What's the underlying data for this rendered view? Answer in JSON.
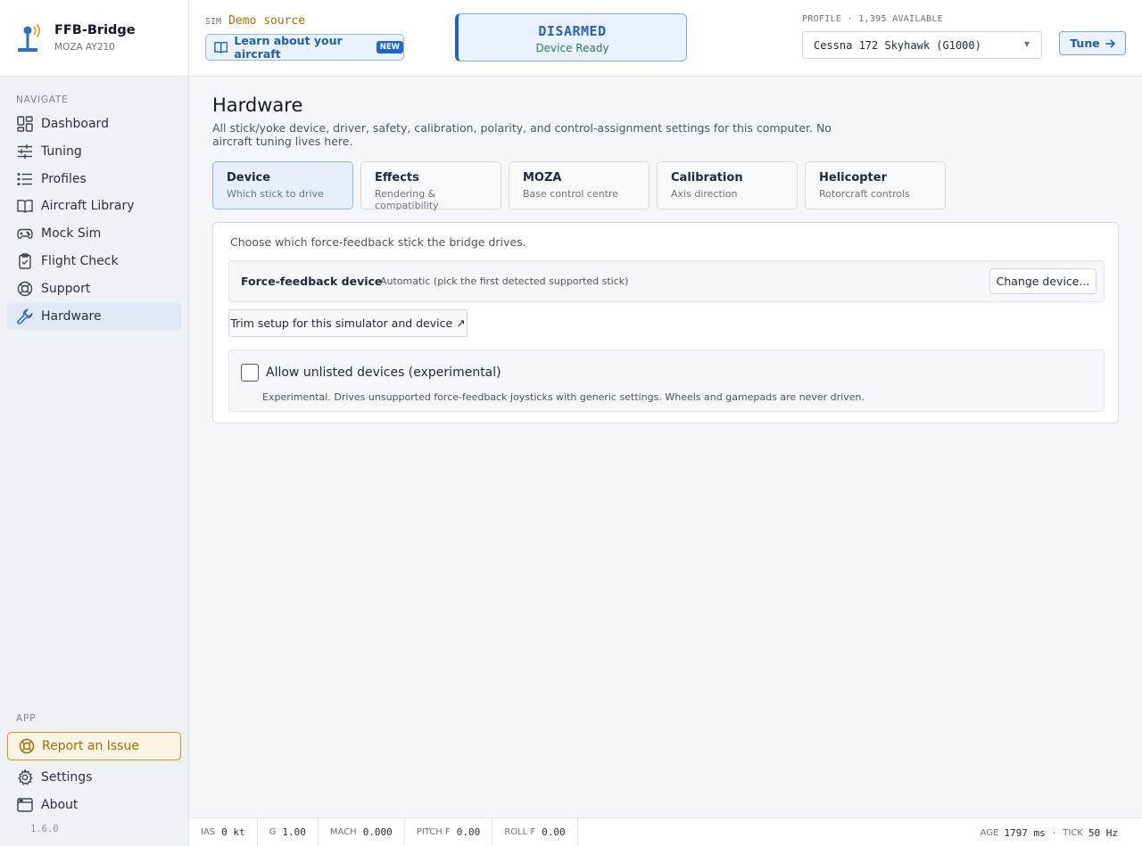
{
  "brand": {
    "title": "FFB-Bridge",
    "subtitle": "MOZA AY210"
  },
  "sidebar": {
    "navigate_heading": "NAVIGATE",
    "items": [
      {
        "label": "Dashboard",
        "icon": "dashboard-icon"
      },
      {
        "label": "Tuning",
        "icon": "sliders-icon"
      },
      {
        "label": "Profiles",
        "icon": "list-icon"
      },
      {
        "label": "Aircraft Library",
        "icon": "book-icon"
      },
      {
        "label": "Mock Sim",
        "icon": "gamepad-icon"
      },
      {
        "label": "Flight Check",
        "icon": "clipboard-check-icon"
      },
      {
        "label": "Support",
        "icon": "lifebuoy-icon"
      },
      {
        "label": "Hardware",
        "icon": "wrench-icon",
        "active": true
      }
    ],
    "app_heading": "APP",
    "report_label": "Report an Issue",
    "settings_label": "Settings",
    "about_label": "About",
    "version": "1.6.0"
  },
  "header": {
    "sim_tag": "SIM",
    "sim_source": "Demo source",
    "learn_label": "Learn about your aircraft",
    "new_badge": "NEW",
    "status_main": "DISARMED",
    "status_sub": "Device Ready",
    "profile_label": "PROFILE · 1,395 AVAILABLE",
    "profile_value": "Cessna 172 Skyhawk (G1000)",
    "tune_label": "Tune"
  },
  "main": {
    "title": "Hardware",
    "description": "All stick/yoke device, driver, safety, calibration, polarity, and control-assignment settings for this computer. No aircraft tuning lives here.",
    "tabs": [
      {
        "label": "Device",
        "sub": "Which stick to drive",
        "active": true
      },
      {
        "label": "Effects",
        "sub": "Rendering & compatibility"
      },
      {
        "label": "MOZA",
        "sub": "Base control centre"
      },
      {
        "label": "Calibration",
        "sub": "Axis direction"
      },
      {
        "label": "Helicopter",
        "sub": "Rotorcraft controls"
      }
    ],
    "panel": {
      "intro": "Choose which force-feedback stick the bridge drives.",
      "ffb_name": "Force-feedback device",
      "ffb_value": "Automatic (pick the first detected supported stick)",
      "change_label": "Change device...",
      "trim_label": "Trim setup for this simulator and device ↗",
      "unlisted_label": "Allow unlisted devices (experimental)",
      "unlisted_desc": "Experimental. Drives unsupported force-feedback joysticks with generic settings. Wheels and gamepads are never driven."
    }
  },
  "footer": {
    "metrics": [
      {
        "k": "IAS",
        "v": "0 kt"
      },
      {
        "k": "G",
        "v": "1.00"
      },
      {
        "k": "MACH",
        "v": "0.000"
      },
      {
        "k": "PITCH F",
        "v": "0.00"
      },
      {
        "k": "ROLL F",
        "v": "0.00"
      }
    ],
    "age_k": "AGE",
    "age_v": "1797 ms",
    "tick_k": "TICK",
    "tick_v": "50 Hz"
  },
  "colors": {
    "accent": "#2563c2",
    "warning": "#c9951f",
    "ready": "#2f7a53"
  }
}
